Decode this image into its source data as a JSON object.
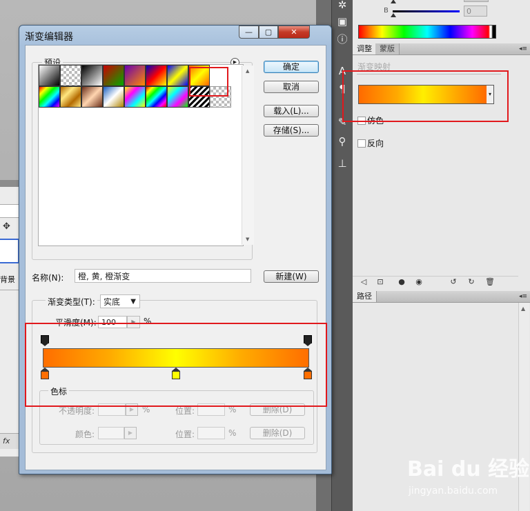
{
  "dialog": {
    "title": "渐变编辑器",
    "window_controls": {
      "minimize": "—",
      "maximize": "▢",
      "close": "✕"
    },
    "presets_label": "预设",
    "buttons": {
      "ok": "确定",
      "cancel": "取消",
      "load": "载入(L)...",
      "save": "存储(S)...",
      "new": "新建(W)"
    },
    "name_label": "名称(N):",
    "name_value": "橙, 黄, 橙渐变",
    "type_label": "渐变类型(T):",
    "type_value": "实底",
    "smooth_label": "平滑度(M):",
    "smooth_value": "100",
    "smooth_unit": "%",
    "stops_group_label": "色标",
    "opacity_label": "不透明度:",
    "opacity_unit": "%",
    "location_label": "位置:",
    "location_unit": "%",
    "delete_label": "删除(D)",
    "color_label": "颜色:",
    "gradient_colors": [
      "#ff6e00",
      "#ffff00",
      "#ff6e00"
    ]
  },
  "right_panel": {
    "b_label": "B",
    "b_value": "0",
    "tabs": [
      "调整",
      "蒙版"
    ],
    "adjustment_title": "渐变映射",
    "dither_label": "仿色",
    "reverse_label": "反向",
    "paths_tab": "路径"
  },
  "left_fragment": {
    "layer_label": "背景",
    "fx_label": "fx"
  },
  "watermark": {
    "brand": "Bai du 经验",
    "url": "jingyan.baidu.com"
  }
}
